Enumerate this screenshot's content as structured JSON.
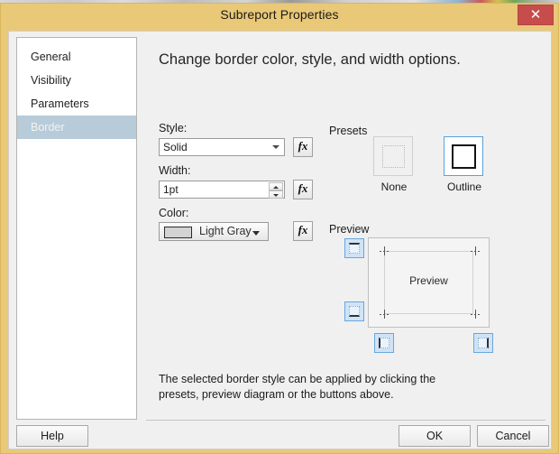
{
  "window": {
    "title": "Subreport Properties",
    "close_label": "✕",
    "frame_color": "#e9c877",
    "close_color": "#c74d4d"
  },
  "sidebar": {
    "items": [
      {
        "label": "General",
        "selected": false
      },
      {
        "label": "Visibility",
        "selected": false
      },
      {
        "label": "Parameters",
        "selected": false
      },
      {
        "label": "Border",
        "selected": true
      }
    ],
    "selected_color": "#b8cbd9"
  },
  "main": {
    "heading": "Change border color, style, and width options.",
    "hint": "The selected border style can be applied by clicking the presets, preview diagram or the buttons above.",
    "fields": {
      "style": {
        "label": "Style:",
        "value": "Solid",
        "options": [
          "Solid"
        ],
        "fx_label": "fx"
      },
      "width": {
        "label": "Width:",
        "value": "1pt",
        "fx_label": "fx"
      },
      "color": {
        "label": "Color:",
        "value": "Light Gray",
        "swatch": "#d3d3d3",
        "fx_label": "fx"
      }
    },
    "presets": {
      "label": "Presets",
      "items": [
        {
          "caption": "None",
          "selected": false,
          "icon": "dotted-square-icon"
        },
        {
          "caption": "Outline",
          "selected": true,
          "icon": "solid-square-icon"
        }
      ],
      "selected_border_color": "#5aa0dd"
    },
    "preview": {
      "label": "Preview",
      "box_text": "Preview",
      "edge_buttons": [
        {
          "name": "top-border-button",
          "edge": "top"
        },
        {
          "name": "bottom-border-button",
          "edge": "bottom"
        },
        {
          "name": "left-border-button",
          "edge": "left"
        },
        {
          "name": "right-border-button",
          "edge": "right"
        }
      ]
    }
  },
  "footer": {
    "help_label": "Help",
    "ok_label": "OK",
    "cancel_label": "Cancel"
  }
}
